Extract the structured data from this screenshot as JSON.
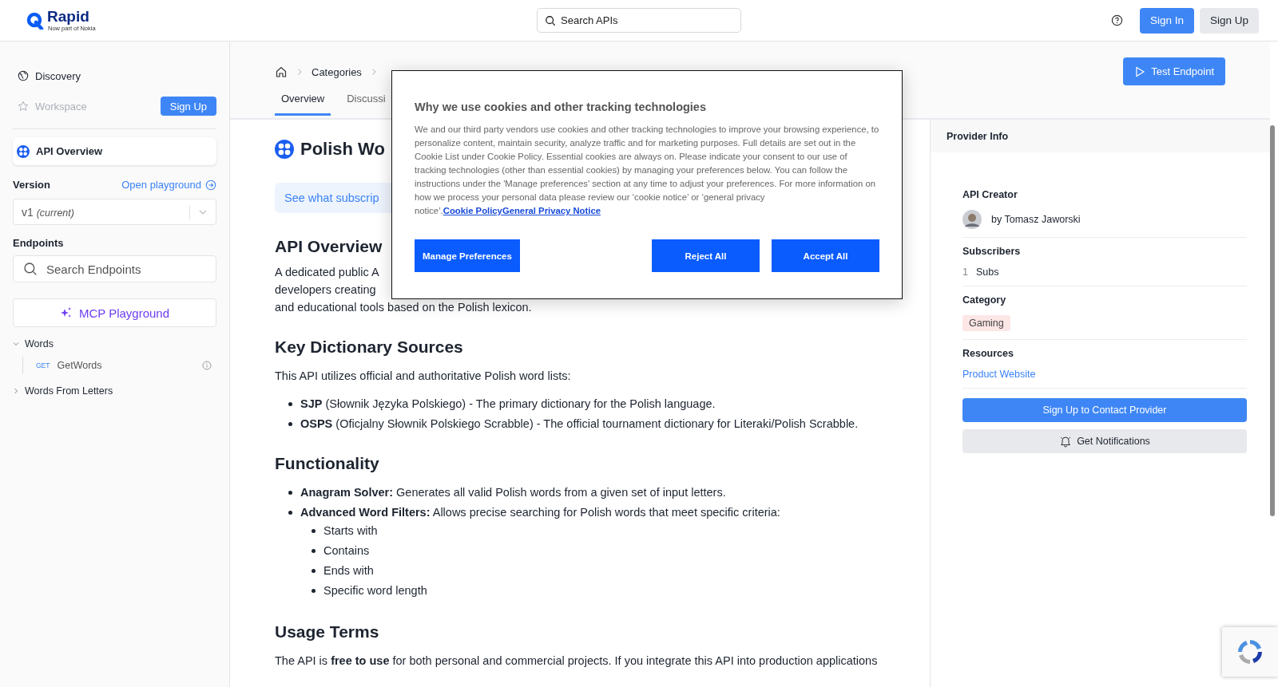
{
  "header": {
    "logo": {
      "name": "Rapid",
      "tagline": "Now part of Nokia"
    },
    "search": {
      "placeholder": "Search APIs"
    },
    "sign_in": "Sign In",
    "sign_up": "Sign Up"
  },
  "sidebar": {
    "nav": [
      {
        "label": "Discovery",
        "disabled": false
      },
      {
        "label": "Workspace",
        "disabled": true
      }
    ],
    "sign_up": "Sign Up",
    "api_overview": {
      "label": "API Overview",
      "selected": true
    },
    "version": {
      "label": "Version",
      "link": "Open playground",
      "value": "v1",
      "note": "(current)"
    },
    "endpoints": {
      "label": "Endpoints",
      "search": {
        "placeholder": "Search Endpoints"
      }
    },
    "mcp_button": "MCP Playground",
    "tree": [
      {
        "label": "Words",
        "expanded": true,
        "children": [
          {
            "method": "GET",
            "label": "GetWords"
          }
        ]
      },
      {
        "label": "Words From Letters",
        "expanded": false
      }
    ]
  },
  "main": {
    "breadcrumb": [
      "Categories"
    ],
    "test_button": "Test Endpoint",
    "tabs": [
      {
        "label": "Overview",
        "selected": true
      },
      {
        "label": "Discussi",
        "selected": false
      }
    ],
    "title": "Polish Wo",
    "banner": "See what subscrip",
    "intro": {
      "heading": "API Overview",
      "lines": [
        "A dedicated public A",
        "developers creating",
        "and educational tools based on the Polish lexicon."
      ]
    },
    "sections": [
      {
        "heading": "Key Dictionary Sources",
        "paragraph": "This API utilizes official and authoritative Polish word lists:",
        "bullets": [
          {
            "text": "**SJP** (Słownik Języka Polskiego) - The primary dictionary for the Polish language."
          },
          {
            "text": "**OSPS** (Oficjalny Słownik Polskiego Scrabble) - The official tournament dictionary for Literaki/Polish Scrabble."
          }
        ]
      },
      {
        "heading": "Functionality",
        "bullets": [
          {
            "text": "**Anagram Solver:** Generates all valid Polish words from a given set of input letters."
          },
          {
            "text": "**Advanced Word Filters:** Allows precise searching for Polish words that meet specific criteria:",
            "children": [
              "Starts with",
              "Contains",
              "Ends with",
              "Specific word length"
            ]
          }
        ]
      },
      {
        "heading": "Usage Terms",
        "paragraph": "The API is **free to use** for both personal and commercial projects. If you integrate this API into production applications"
      }
    ]
  },
  "provider": {
    "title": "Provider Info",
    "creator_label": "API Creator",
    "creator": "by Tomasz Jaworski",
    "subscribers_label": "Subscribers",
    "subscribers_count": "1",
    "subscribers_unit": "Subs",
    "category_label": "Category",
    "category": "Gaming",
    "resources_label": "Resources",
    "resource_link": "Product Website",
    "contact_button": "Sign Up to Contact Provider",
    "notify_button": "Get Notifications"
  },
  "cookie_dialog": {
    "title": "Why we use cookies and other tracking technologies",
    "body": "We and our third party vendors use cookies and other tracking technologies to improve your browsing experience, to personalize content, maintain security, analyze traffic and for marketing purposes. Full details are set out in the Cookie List under Cookie Policy. Essential cookies are always on. Please indicate your consent to our use of tracking technologies (other than essential cookies) by managing your preferences below. You can follow the instructions under the 'Manage preferences' section at any time to adjust your preferences. For more information on how we process your personal data please review our ‘cookie notice’ or ‘general privacy notice’.",
    "links": [
      "Cookie Policy",
      "General Privacy Notice"
    ],
    "manage_button": "Manage Preferences",
    "reject_button": "Reject All",
    "accept_button": "Accept All"
  }
}
